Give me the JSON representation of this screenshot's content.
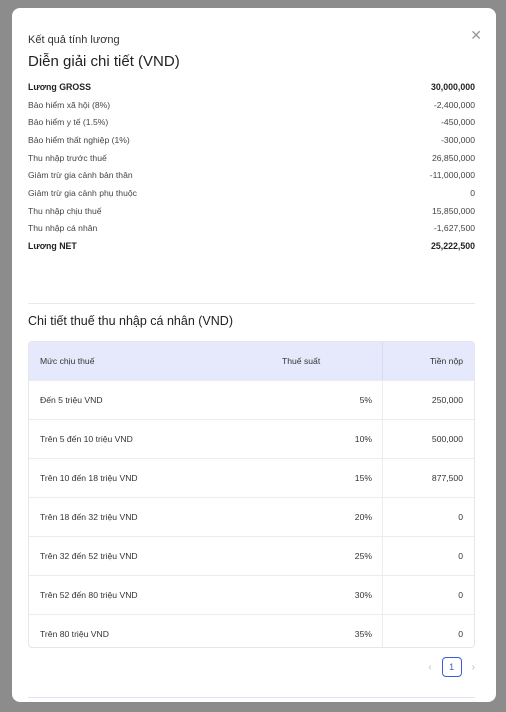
{
  "modal": {
    "header_label": "Kết quả tính lương",
    "close_icon": "close-icon",
    "title": "Diễn giải chi tiết (VND)",
    "breakdown": [
      {
        "label": "Lương GROSS",
        "value": "30,000,000",
        "bold": true
      },
      {
        "label": "Bảo hiểm xã hội (8%)",
        "value": "-2,400,000"
      },
      {
        "label": "Bảo hiểm y tế (1.5%)",
        "value": "-450,000"
      },
      {
        "label": "Bảo hiểm thất nghiệp (1%)",
        "value": "-300,000"
      },
      {
        "label": "Thu nhập trước thuế",
        "value": "26,850,000"
      },
      {
        "label": "Giảm trừ gia cảnh bản thân",
        "value": "-11,000,000"
      },
      {
        "label": "Giảm trừ gia cảnh phụ thuộc",
        "value": "0"
      },
      {
        "label": "Thu nhập chịu thuế",
        "value": "15,850,000"
      },
      {
        "label": "Thu nhập cá nhân",
        "value": "-1,627,500"
      },
      {
        "label": "Lương NET",
        "value": "25,222,500",
        "bold": true
      }
    ],
    "tax_title": "Chi tiết thuế thu nhập cá nhân (VND)",
    "tax_table": {
      "headers": [
        "Mức chịu thuế",
        "Thuế suất",
        "Tiền nộp"
      ],
      "rows": [
        [
          "Đến 5 triệu VND",
          "5%",
          "250,000"
        ],
        [
          "Trên 5 đến 10 triệu VND",
          "10%",
          "500,000"
        ],
        [
          "Trên 10 đến 18 triệu VND",
          "15%",
          "877,500"
        ],
        [
          "Trên 18 đến 32 triệu VND",
          "20%",
          "0"
        ],
        [
          "Trên 32 đến 52 triệu VND",
          "25%",
          "0"
        ],
        [
          "Trên 52 đến 80 triệu VND",
          "30%",
          "0"
        ],
        [
          "Trên 80 triệu VND",
          "35%",
          "0"
        ]
      ]
    },
    "pagination": {
      "prev": "‹",
      "current": "1",
      "next": "›"
    }
  },
  "colors": {
    "accent": "#3b5bdb",
    "table_header_bg": "#e6e9fb",
    "backdrop": "#8c8c8c"
  }
}
